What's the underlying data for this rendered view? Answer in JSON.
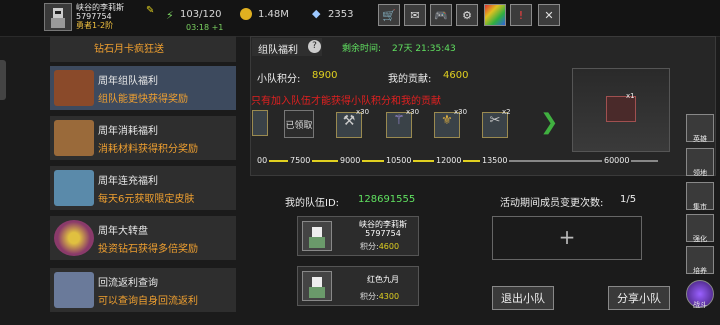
{
  "player": {
    "name": "峡谷的李莉斯",
    "id": "5797754",
    "title": "勇者1-2阶"
  },
  "header": {
    "energy": "103/120",
    "timer": "03:18 +1",
    "coins": "1.48M",
    "gems": "2353",
    "icons": [
      "cart-icon",
      "mail-icon",
      "controller-icon",
      "gear-icon",
      "rainbow-icon",
      "alert-icon",
      "close-icon"
    ]
  },
  "menu": [
    {
      "title": "",
      "subtitle": "钻石月卡疯狂送",
      "selected": false
    },
    {
      "title": "周年组队福利",
      "subtitle": "组队能更快获得奖励",
      "selected": true
    },
    {
      "title": "周年消耗福利",
      "subtitle": "消耗材料获得积分奖励",
      "selected": false
    },
    {
      "title": "周年连充福利",
      "subtitle": "每天6元获取限定皮肤",
      "selected": false
    },
    {
      "title": "周年大转盘",
      "subtitle": "投资钻石获得多倍奖励",
      "selected": false
    },
    {
      "title": "回流返利查询",
      "subtitle": "可以查询自身回流返利",
      "selected": false
    }
  ],
  "event": {
    "tab": "组队福利",
    "countdown_label": "剩余时间:",
    "countdown": "27天 21:35:43",
    "team_points_label": "小队积分:",
    "team_points": "8900",
    "my_contrib_label": "我的贡献:",
    "my_contrib": "4600",
    "notice": "只有加入队伍才能获得小队积分和我的贡献",
    "claimed": "已领取",
    "reward_counts": [
      "x30",
      "x30",
      "x30",
      "x2",
      "x1"
    ],
    "milestones": [
      "00",
      "7500",
      "9000",
      "10500",
      "12000",
      "13500",
      "60000"
    ],
    "progress_fraction": 0.6
  },
  "team": {
    "id_label": "我的队伍ID:",
    "id": "128691555",
    "change_label": "活动期间成员变更次数:",
    "change_count": "1/5",
    "members": [
      {
        "name": "峡谷的李莉斯",
        "id": "5797754",
        "points_label": "积分:",
        "points": "4600"
      },
      {
        "name": "红色九月",
        "id": "",
        "points_label": "积分:",
        "points": "4300"
      }
    ],
    "add_symbol": "+",
    "leave": "退出小队",
    "share": "分享小队"
  },
  "sidebar": [
    "英雄",
    "领地",
    "集市",
    "强化",
    "培养",
    "战斗"
  ]
}
